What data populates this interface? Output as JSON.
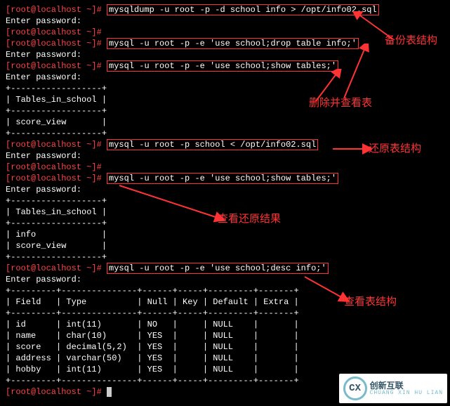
{
  "prompt": "[root@localhost ~]#",
  "cmd1": "mysqldump -u root -p -d school info > /opt/info02.sql",
  "enter_pw": "Enter password:",
  "cmd2": "mysql -u root -p -e 'use school;drop table info;'",
  "cmd3": "mysql -u root -p -e 'use school;show tables;'",
  "table_header1": "| Tables_in_school |",
  "hr1_a": "+------------------+",
  "hr1_b": "+------------------+",
  "row_scoreview": "| score_view       |",
  "row_info": "| info             |",
  "cmd4": "mysql -u root -p school < /opt/info02.sql",
  "cmd5": "mysql -u root -p -e 'use school;show tables;'",
  "cmd6": "mysql -u root -p -e 'use school;desc info;'",
  "desc_hr": "+---------+---------------+------+-----+---------+-------+",
  "desc_head": "| Field   | Type          | Null | Key | Default | Extra |",
  "desc_r1": "| id      | int(11)       | NO   |     | NULL    |       |",
  "desc_r2": "| name    | char(10)      | YES  |     | NULL    |       |",
  "desc_r3": "| score   | decimal(5,2)  | YES  |     | NULL    |       |",
  "desc_r4": "| address | varchar(50)   | YES  |     | NULL    |       |",
  "desc_r5": "| hobby   | int(11)       | YES  |     | NULL    |       |",
  "ann1": "备份表结构",
  "ann2": "删除并查看表",
  "ann3": "还原表结构",
  "ann4": "查看还原结果",
  "ann5": "查看表结构",
  "logo_text": "创新互联",
  "logo_sub": "CHUANG XIN HU LIAN",
  "logo_initials": "CX",
  "cursor": " "
}
